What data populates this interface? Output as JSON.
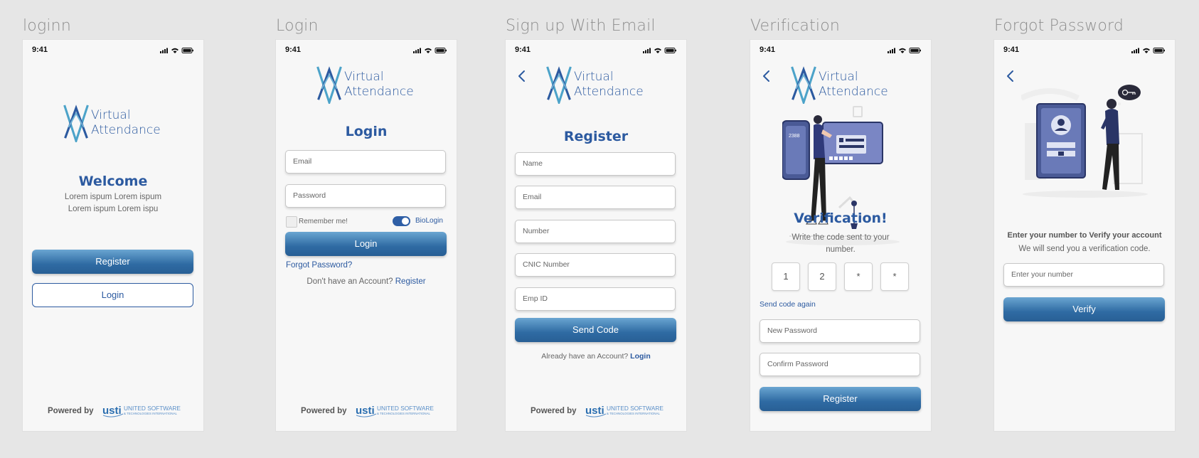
{
  "colors": {
    "brand": "#2c5aa0",
    "button_gradient_top": "#6aa5d1",
    "button_gradient_bottom": "#285f95",
    "canvas": "#e6e6e6"
  },
  "status_time": "9:41",
  "brand": {
    "line1": "Virtual",
    "line2": "Attendance"
  },
  "powered": {
    "label": "Powered by",
    "company": "UNITED SOFTWARE",
    "company_sub": "& TECHNOLOGIES INTERNATIONAL"
  },
  "screens": {
    "welcome": {
      "frame_title": "loginn",
      "heading": "Welcome",
      "sub1": "Lorem ispum Lorem ispum",
      "sub2": "Lorem ispum Lorem ispu",
      "register_button": "Register",
      "login_button": "Login"
    },
    "login": {
      "frame_title": "Login",
      "heading": "Login",
      "email_placeholder": "Email",
      "password_placeholder": "Password",
      "remember_label": "Remember me!",
      "biologin_label": "BioLogin",
      "login_button": "Login",
      "forgot_link": "Forgot Password?",
      "no_account_text": "Don't have an Account?",
      "register_link": "Register"
    },
    "signup": {
      "frame_title": "Sign up With Email",
      "heading": "Register",
      "name_placeholder": "Name",
      "email_placeholder": "Email",
      "number_placeholder": "Number",
      "cnic_placeholder": "CNIC Number",
      "empid_placeholder": "Emp ID",
      "send_code_button": "Send Code",
      "have_account_text": "Already have an Account?",
      "login_link": "Login"
    },
    "verification": {
      "frame_title": "Verification",
      "heading": "Verification!",
      "sub1": "Write the code sent to your",
      "sub2": "number.",
      "code_digits": [
        "1",
        "2",
        "*",
        "*"
      ],
      "send_again_link": "Send code again",
      "new_password_placeholder": "New Password",
      "confirm_password_placeholder": "Confirm Password",
      "register_button": "Register",
      "illustration_text": "2388"
    },
    "forgot": {
      "frame_title": "Forgot Password",
      "heading": "Enter your number to Verify your account",
      "sub": "We will send you a verification code.",
      "number_placeholder": "Enter your number",
      "verify_button": "Verify"
    }
  }
}
